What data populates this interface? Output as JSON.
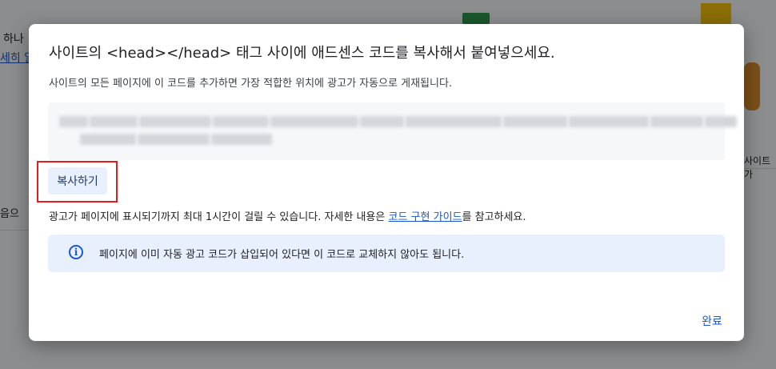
{
  "background": {
    "fragment_1": "하나",
    "fragment_2": "세히 알",
    "fragment_3": "음으",
    "fragment_4": "사이트가"
  },
  "dialog": {
    "title": "사이트의 <head></head> 태그 사이에 애드센스 코드를 복사해서 붙여넣으세요.",
    "subtitle": "사이트의 모든 페이지에 이 코드를 추가하면 가장 적합한 위치에 광고가 자동으로 게재됩니다.",
    "copy_button": "복사하기",
    "note_prefix": "광고가 페이지에 표시되기까지 최대 1시간이 걸릴 수 있습니다. 자세한 내용은 ",
    "note_link": "코드 구현 가이드",
    "note_suffix": "를 참고하세요.",
    "info_icon": "info-icon",
    "info_text": "페이지에 이미 자동 광고 코드가 삽입되어 있다면 이 코드로 교체하지 않아도 됩니다.",
    "done_button": "완료"
  },
  "colors": {
    "accent": "#1a57d0",
    "info_bg": "#e8f0fe",
    "highlight": "#e21d1d"
  }
}
